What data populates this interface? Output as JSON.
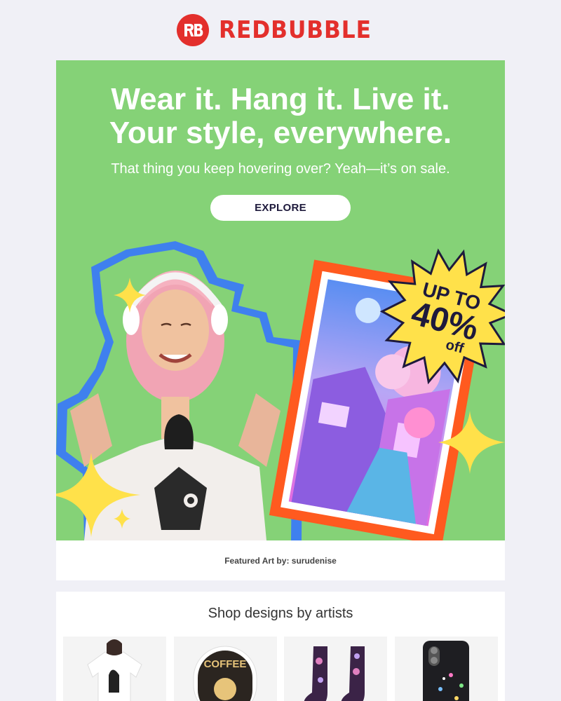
{
  "brand": {
    "name": "REDBUBBLE",
    "color": "#e32f2c"
  },
  "hero": {
    "headline_line1": "Wear it. Hang it. Live it.",
    "headline_line2": "Your style, everywhere.",
    "subhead": "That thing you keep hovering over? Yeah—it’s on sale.",
    "cta_label": "EXPLORE",
    "background_color": "#85d277",
    "badge": {
      "line1": "UP TO",
      "line2": "40%",
      "line3": "off",
      "color": "#ffe14a"
    }
  },
  "credit": {
    "text": "Featured Art by: surudenise"
  },
  "shop": {
    "title": "Shop designs by artists",
    "products": [
      {
        "name": "t-shirt",
        "icon": "tshirt-product"
      },
      {
        "name": "sticker",
        "icon": "coffee-sticker-product",
        "label": "COFFEE"
      },
      {
        "name": "socks",
        "icon": "socks-product"
      },
      {
        "name": "phone case",
        "icon": "phone-case-product"
      }
    ]
  }
}
